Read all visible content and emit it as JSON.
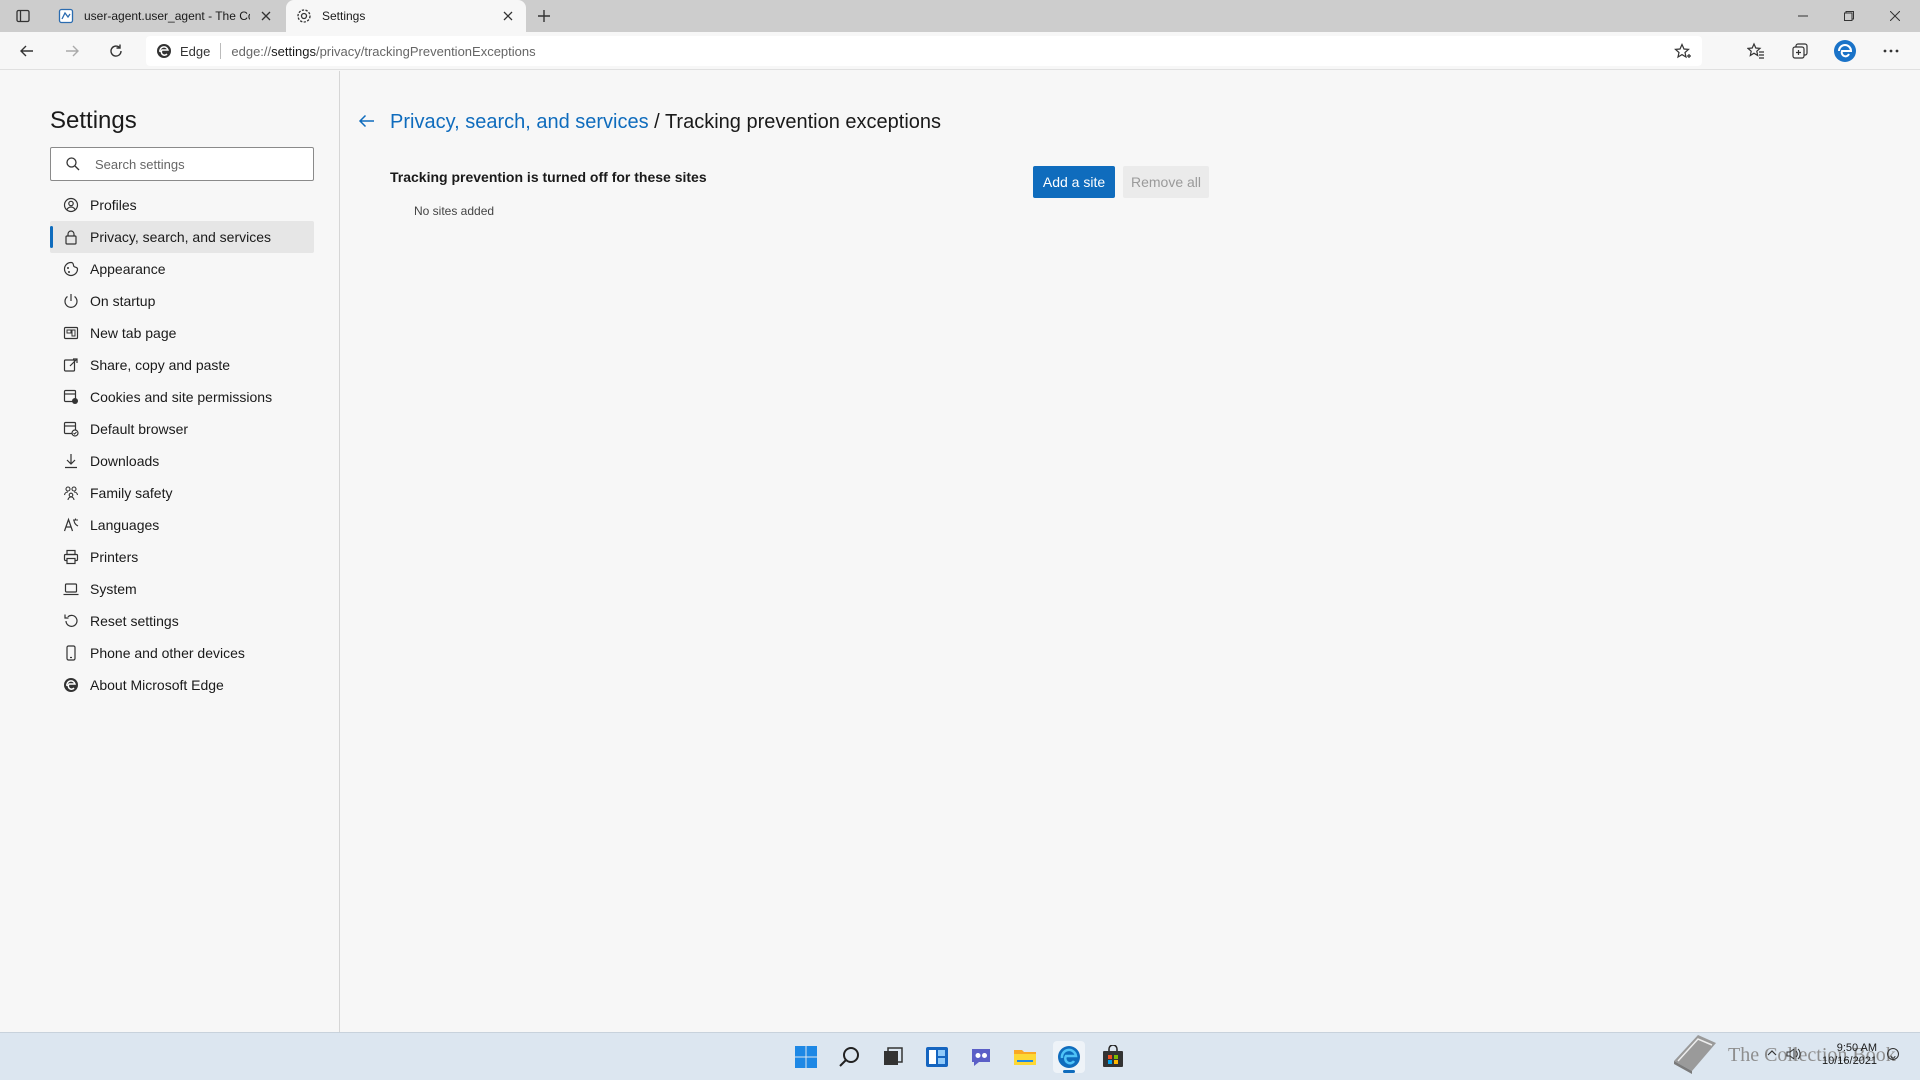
{
  "browser": {
    "tabs": [
      {
        "title": "user-agent.user_agent - The Coll",
        "icon": "document-icon",
        "active": false
      },
      {
        "title": "Settings",
        "icon": "gear-icon",
        "active": true
      }
    ],
    "address": {
      "scheme_label": "Edge",
      "url_prefix": "edge://",
      "url_bold": "settings",
      "url_rest": "/privacy/trackingPreventionExceptions"
    }
  },
  "sidebar": {
    "title": "Settings",
    "search_placeholder": "Search settings",
    "items": [
      {
        "label": "Profiles",
        "icon": "profile-icon"
      },
      {
        "label": "Privacy, search, and services",
        "icon": "lock-icon",
        "active": true
      },
      {
        "label": "Appearance",
        "icon": "appearance-icon"
      },
      {
        "label": "On startup",
        "icon": "power-icon"
      },
      {
        "label": "New tab page",
        "icon": "new-tab-icon"
      },
      {
        "label": "Share, copy and paste",
        "icon": "share-icon"
      },
      {
        "label": "Cookies and site permissions",
        "icon": "cookies-icon"
      },
      {
        "label": "Default browser",
        "icon": "default-browser-icon"
      },
      {
        "label": "Downloads",
        "icon": "download-icon"
      },
      {
        "label": "Family safety",
        "icon": "family-icon"
      },
      {
        "label": "Languages",
        "icon": "languages-icon"
      },
      {
        "label": "Printers",
        "icon": "printer-icon"
      },
      {
        "label": "System",
        "icon": "laptop-icon"
      },
      {
        "label": "Reset settings",
        "icon": "reset-icon"
      },
      {
        "label": "Phone and other devices",
        "icon": "phone-icon"
      },
      {
        "label": "About Microsoft Edge",
        "icon": "edge-icon"
      }
    ]
  },
  "main": {
    "breadcrumb_parent": "Privacy, search, and services",
    "breadcrumb_separator": " / ",
    "breadcrumb_current": "Tracking prevention exceptions",
    "section_title": "Tracking prevention is turned off for these sites",
    "add_button": "Add a site",
    "remove_button": "Remove all",
    "empty_text": "No sites added"
  },
  "taskbar": {
    "watermark": "The Collection Book",
    "time": "9:50 AM",
    "date": "10/16/2021"
  },
  "colors": {
    "accent": "#0f6cbd",
    "tabstrip": "#cdcdcd",
    "taskbar": "#dce6f0"
  }
}
